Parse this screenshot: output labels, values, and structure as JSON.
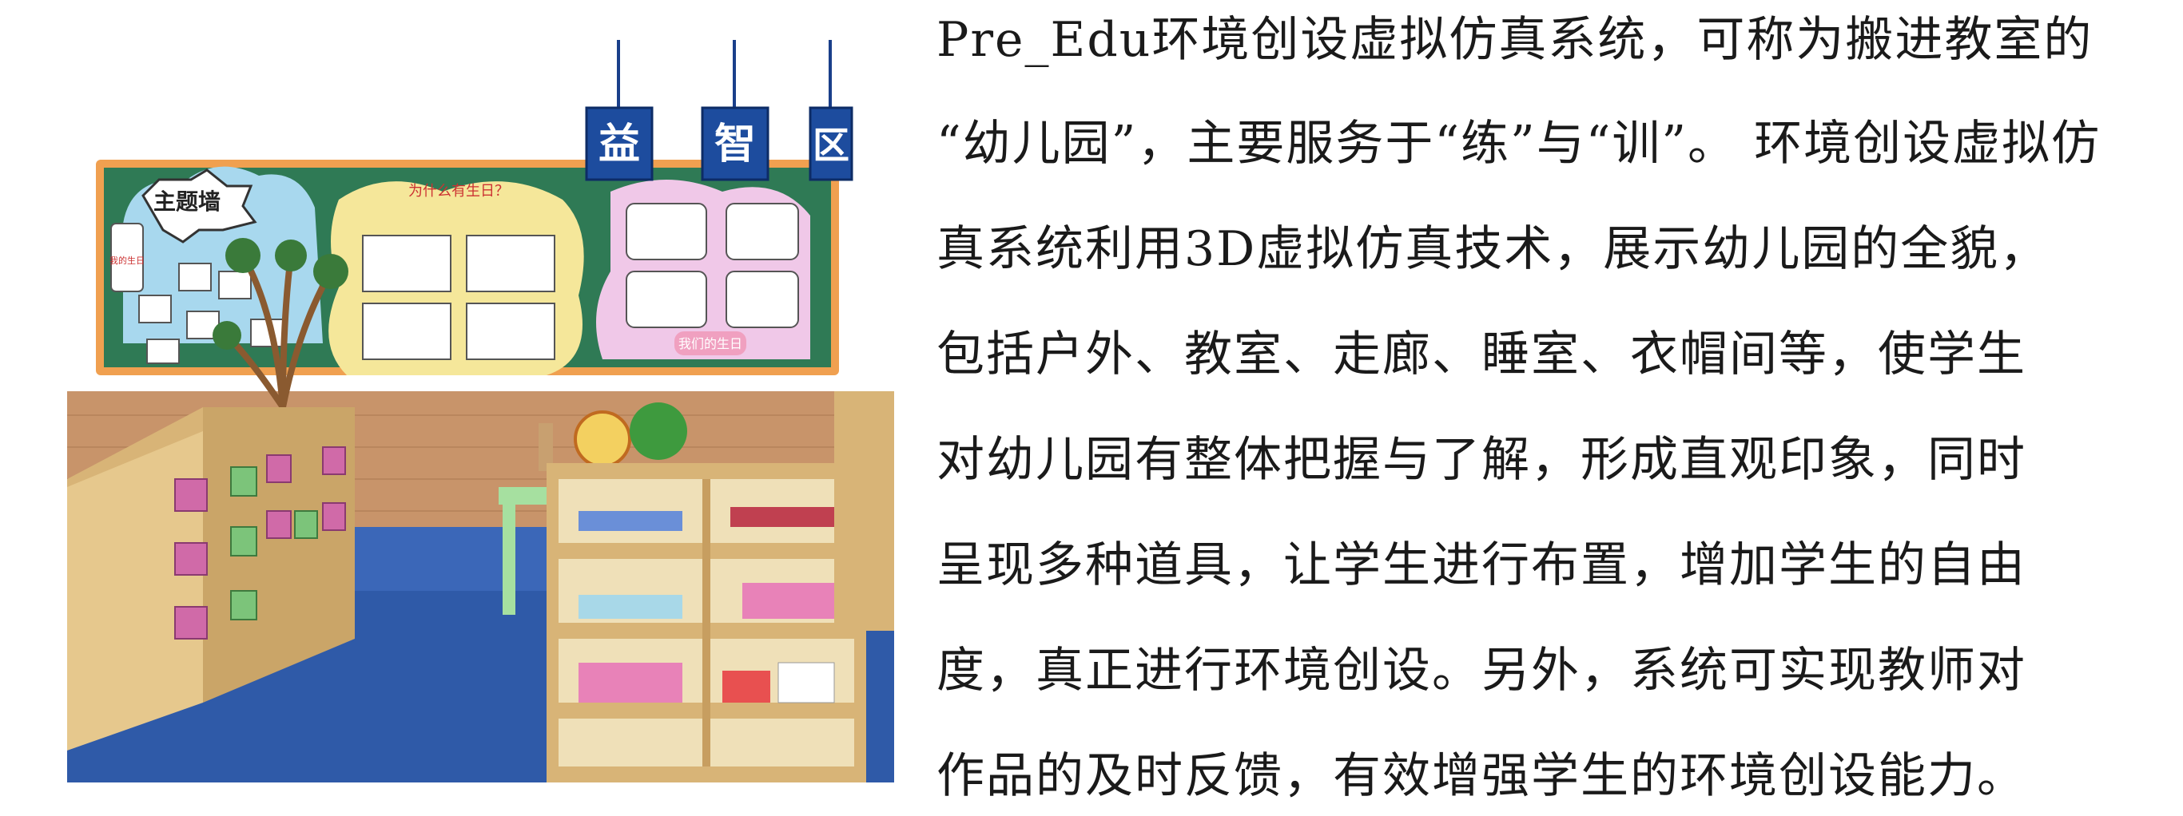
{
  "scene": {
    "theme_wall_label": "主题墙",
    "side_label": "我的生日",
    "banner_chars": [
      "益",
      "智",
      "区"
    ],
    "board_center_title": "为什么有生日？",
    "board_right_caption": "我们的生日"
  },
  "description": {
    "lines": [
      "Pre_Edu环境创设虚拟仿真系统，可称为搬进教室的",
      "“幼儿园”，主要服务于“练”与“训”。 环境创设虚拟仿",
      "真系统利用3D虚拟仿真技术，展示幼儿园的全貌，",
      "包括户外、教室、走廊、睡室、衣帽间等，使学生",
      "对幼儿园有整体把握与了解，形成直观印象，同时",
      "呈现多种道具，让学生进行布置，增加学生的自由",
      "度，真正进行环境创设。另外，系统可实现教师对",
      "作品的及时反馈，有效增强学生的环境创设能力。"
    ]
  }
}
